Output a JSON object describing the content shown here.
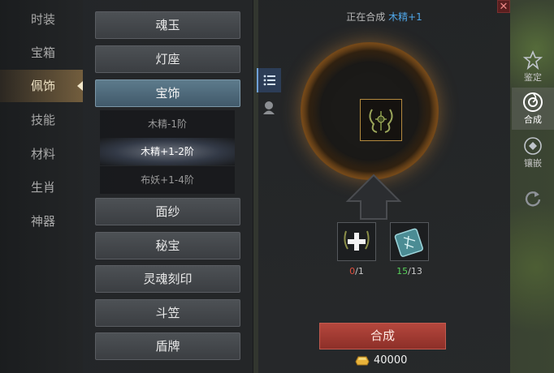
{
  "categories": [
    {
      "label": "时装",
      "active": false
    },
    {
      "label": "宝箱",
      "active": false
    },
    {
      "label": "佩饰",
      "active": true
    },
    {
      "label": "技能",
      "active": false
    },
    {
      "label": "材料",
      "active": false
    },
    {
      "label": "生肖",
      "active": false
    },
    {
      "label": "神器",
      "active": false
    }
  ],
  "items": {
    "hunyu": "魂玉",
    "dengzuo": "灯座",
    "baoshi": "宝饰",
    "sub1": "木精-1阶",
    "sub2": "木精+1-2阶",
    "sub3": "布妖+1-4阶",
    "miansha": "面纱",
    "mibao": "秘宝",
    "linghun": "灵魂刻印",
    "doulì": "斗笠",
    "dunpai": "盾牌"
  },
  "synth": {
    "title_prefix": "正在合成",
    "title_target": "木精+1",
    "mat1_have": "0",
    "mat1_need": "/1",
    "mat2_have": "15",
    "mat2_need": "/13",
    "button": "合成",
    "cost": "40000"
  },
  "func_tabs": {
    "identify": "鉴定",
    "combine": "合成",
    "inlay": "镶嵌"
  },
  "colors": {
    "accent_blue": "#4fa6e8",
    "synth_button": "#a23a32",
    "ring_glow": "#c77c2b"
  }
}
